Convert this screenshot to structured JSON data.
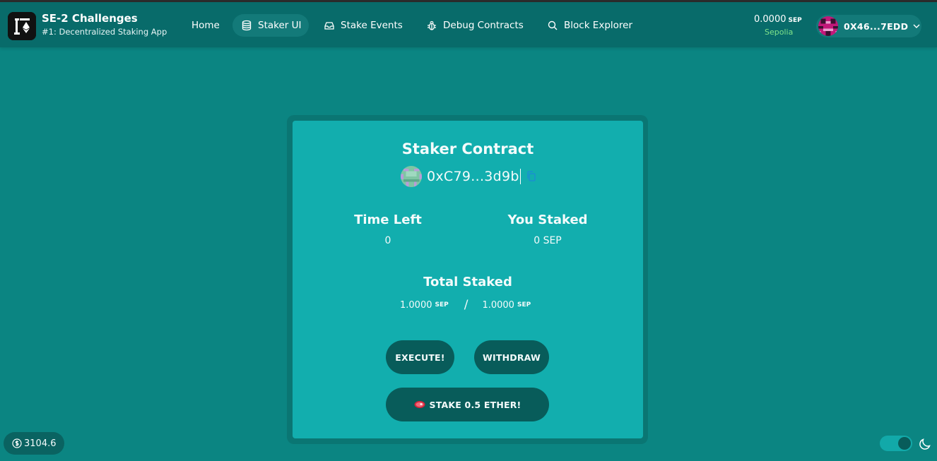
{
  "header": {
    "brand_title": "SE-2 Challenges",
    "brand_subtitle": "#1: Decentralized Staking App",
    "nav": [
      {
        "label": "Home",
        "icon": "none",
        "active": false
      },
      {
        "label": "Staker UI",
        "icon": "database-icon",
        "active": true
      },
      {
        "label": "Stake Events",
        "icon": "inbox-icon",
        "active": false
      },
      {
        "label": "Debug Contracts",
        "icon": "bug-icon",
        "active": false
      },
      {
        "label": "Block Explorer",
        "icon": "search-icon",
        "active": false
      }
    ],
    "balance": {
      "value": "0.0000",
      "unit": "SEP"
    },
    "network": "Sepolia",
    "account_address": "0X46...7EDD"
  },
  "card": {
    "title": "Staker Contract",
    "contract_address": "0xC79...3d9b",
    "time_left": {
      "label": "Time Left",
      "value": "0"
    },
    "you_staked": {
      "label": "You Staked",
      "value": "0 SEP"
    },
    "total_staked": {
      "label": "Total Staked",
      "current": "1.0000",
      "current_unit": "SEP",
      "separator": "/",
      "threshold": "1.0000",
      "threshold_unit": "SEP"
    },
    "buttons": {
      "execute": "EXECUTE!",
      "withdraw": "WITHDRAW",
      "stake": "STAKE 0.5 ETHER!"
    }
  },
  "footer": {
    "eth_price": "3104.6"
  },
  "colors": {
    "background": "#0b8582",
    "header": "#086b6a",
    "card": "#12aeae",
    "button": "#085c5a",
    "network_green": "#7fe38a"
  }
}
